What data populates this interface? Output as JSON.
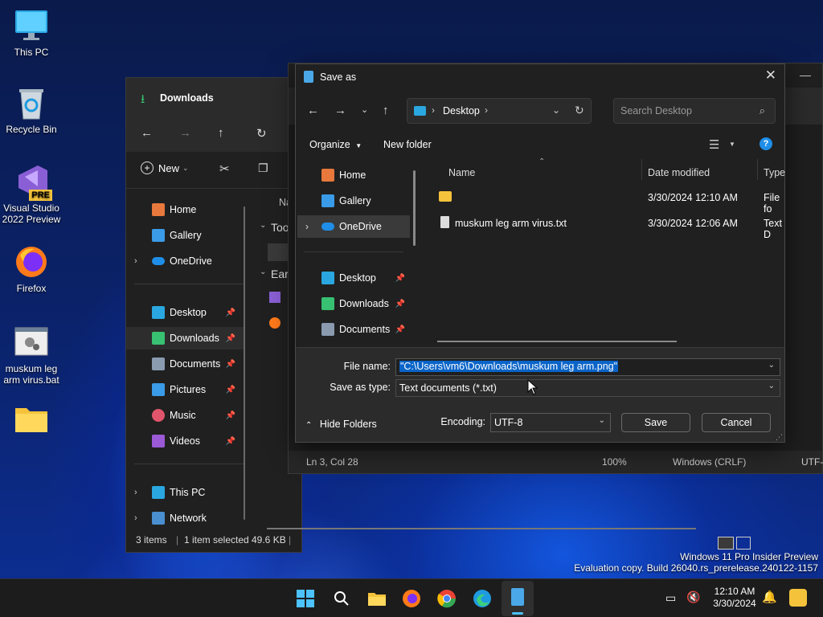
{
  "desktop": {
    "icons": [
      {
        "label": "This PC"
      },
      {
        "label": "Recycle Bin"
      },
      {
        "label": "Visual Studio 2022 Preview",
        "badge": "PRE"
      },
      {
        "label": "Firefox"
      },
      {
        "label": "muskum leg arm virus.bat"
      },
      {
        "label": ""
      }
    ]
  },
  "explorer": {
    "title": "Downloads",
    "new_label": "New",
    "column_name": "Na",
    "group_today": "Too",
    "group_earlier": "Ear",
    "sidebar": [
      {
        "label": "Home",
        "icon": "home-icon"
      },
      {
        "label": "Gallery",
        "icon": "gallery-icon"
      },
      {
        "label": "OneDrive",
        "icon": "onedrive-icon"
      },
      {
        "label": "Desktop",
        "icon": "desktop-icon"
      },
      {
        "label": "Downloads",
        "icon": "download-icon"
      },
      {
        "label": "Documents",
        "icon": "documents-icon"
      },
      {
        "label": "Pictures",
        "icon": "pictures-icon"
      },
      {
        "label": "Music",
        "icon": "music-icon"
      },
      {
        "label": "Videos",
        "icon": "videos-icon"
      },
      {
        "label": "This PC",
        "icon": "pc-icon"
      },
      {
        "label": "Network",
        "icon": "network-icon"
      }
    ],
    "status_items": "3 items",
    "status_selected": "1 item selected",
    "status_size": "49.6 KB"
  },
  "notepad": {
    "status_pos": "Ln 3, Col 28",
    "status_zoom": "100%",
    "status_eol": "Windows (CRLF)",
    "status_enc": "UTF-"
  },
  "dialog": {
    "title": "Save as",
    "breadcrumb": "Desktop",
    "search_placeholder": "Search Desktop",
    "organize_label": "Organize",
    "new_folder_label": "New folder",
    "help_label": "?",
    "nav": [
      {
        "label": "Home"
      },
      {
        "label": "Gallery"
      },
      {
        "label": "OneDrive"
      },
      {
        "label": "Desktop"
      },
      {
        "label": "Downloads"
      },
      {
        "label": "Documents"
      }
    ],
    "columns": {
      "name": "Name",
      "date": "Date modified",
      "type": "Type"
    },
    "files": [
      {
        "name": "",
        "date": "3/30/2024 12:10 AM",
        "type": "File fo"
      },
      {
        "name": "muskum leg arm virus.txt",
        "date": "3/30/2024 12:06 AM",
        "type": "Text D"
      }
    ],
    "filename_label": "File name:",
    "filename_value": "\"C:\\Users\\vm6\\Downloads\\muskum leg arm.png\"",
    "savetype_label": "Save as type:",
    "savetype_value": "Text documents (*.txt)",
    "hide_folders_label": "Hide Folders",
    "encoding_label": "Encoding:",
    "encoding_value": "UTF-8",
    "save_label": "Save",
    "cancel_label": "Cancel"
  },
  "watermark": {
    "line1": "Windows 11 Pro Insider Preview",
    "line2": "Evaluation copy. Build 26040.rs_prerelease.240122-1157"
  },
  "taskbar": {
    "time": "12:10 AM",
    "date": "3/30/2024"
  },
  "colors": {
    "accent": "#0078d4",
    "selection": "#0a64c8",
    "folder": "#f5c33b"
  }
}
